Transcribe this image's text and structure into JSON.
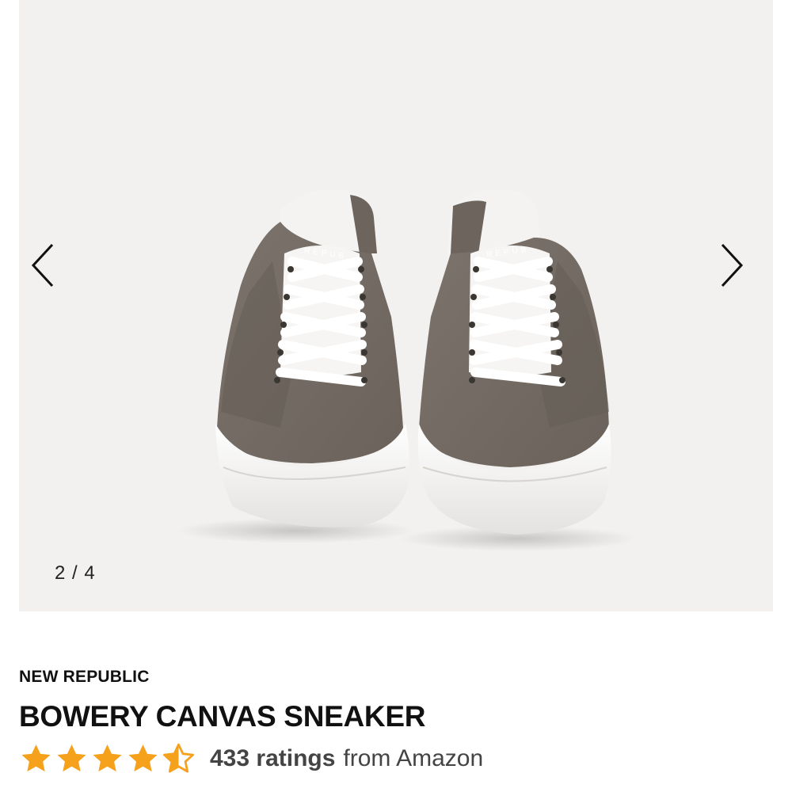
{
  "gallery": {
    "image_alt": "Pair of grey canvas low-top sneakers with white laces and white soles, front view",
    "current": "2 / 4",
    "prev_icon": "chevron-left-icon",
    "next_icon": "chevron-right-icon",
    "shoe_logo_text": "REPUB"
  },
  "product": {
    "brand": "NEW REPUBLIC",
    "title": "BOWERY CANVAS SNEAKER",
    "rating": {
      "stars": 4.5,
      "max_stars": 5,
      "star_color": "#f5a11c",
      "count_label": "433 ratings",
      "source_label": "from Amazon"
    }
  }
}
